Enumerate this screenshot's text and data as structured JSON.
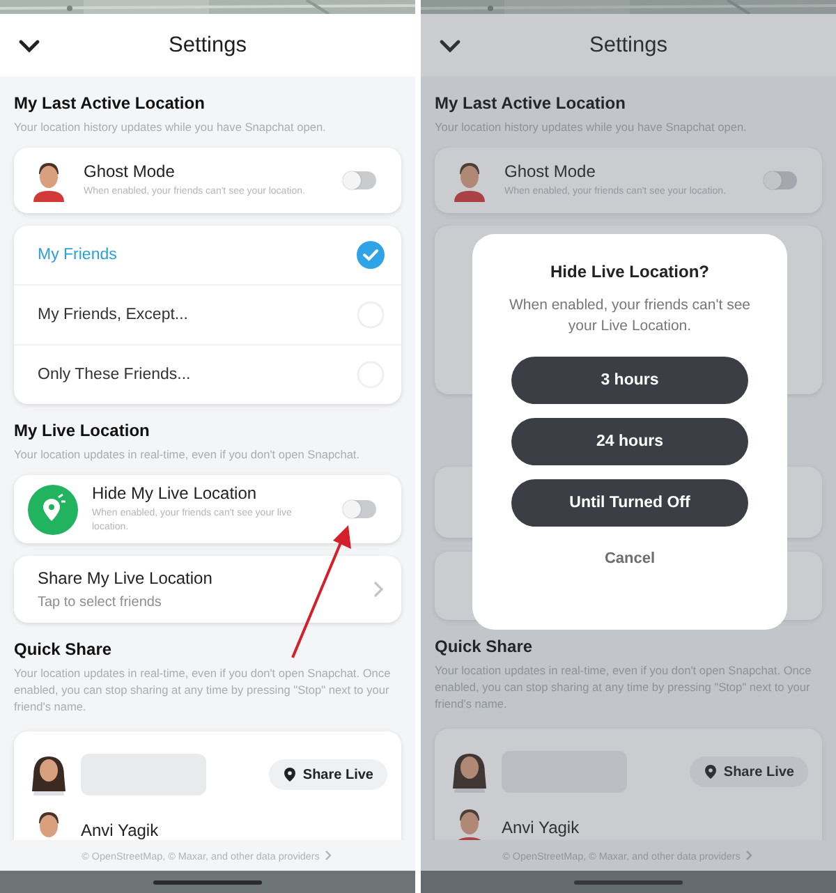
{
  "screens": [
    {
      "header": {
        "title": "Settings"
      },
      "pointer_arrow": true,
      "sections": [
        {
          "kind": "heading",
          "heading": "My Last Active Location",
          "note": "Your location history updates while you have Snapchat open."
        },
        {
          "kind": "avatar-toggle-card",
          "title": "Ghost Mode",
          "note": "When enabled, your friends can't see your location.",
          "on": false
        },
        {
          "kind": "radio-list",
          "items": [
            {
              "label": "My Friends",
              "selected": true
            },
            {
              "label": "My Friends, Except...",
              "selected": false
            },
            {
              "label": "Only These Friends...",
              "selected": false
            }
          ]
        },
        {
          "kind": "heading",
          "heading": "My Live Location",
          "note": "Your location updates in real-time, even if you don't open Snapchat."
        },
        {
          "kind": "pin-toggle-card",
          "title": "Hide My Live Location",
          "note": "When enabled, your friends can't see your live location.",
          "on": false
        },
        {
          "kind": "link-card",
          "title": "Share My Live Location",
          "note": "Tap to select friends"
        },
        {
          "kind": "heading",
          "heading": "Quick Share",
          "note": "Your location updates in real-time, even if you don't open Snapchat. Once enabled, you can stop sharing at any time by pressing \"Stop\" next to your friend's name."
        },
        {
          "kind": "friend-list",
          "items": [
            {
              "redacted": true,
              "button": "Share Live"
            },
            {
              "name": "Anvi Yagik"
            }
          ]
        }
      ],
      "footer": "© OpenStreetMap, © Maxar, and other data providers"
    },
    {
      "header": {
        "title": "Settings"
      },
      "sections": [
        {
          "kind": "heading",
          "heading": "My Last Active Location",
          "note": "Your location history updates while you have Snapchat open."
        },
        {
          "kind": "avatar-toggle-card",
          "title": "Ghost Mode",
          "note": "When enabled, your friends can't see your location.",
          "on": false
        },
        {
          "kind": "covered"
        },
        {
          "kind": "heading",
          "heading": "Quick Share",
          "note": "Your location updates in real-time, even if you don't open Snapchat. Once enabled, you can stop sharing at any time by pressing \"Stop\" next to your friend's name."
        },
        {
          "kind": "friend-list",
          "items": [
            {
              "redacted": true,
              "button": "Share Live"
            },
            {
              "name": "Anvi Yagik"
            }
          ]
        }
      ],
      "footer": "© OpenStreetMap, © Maxar, and other data providers",
      "dialog": {
        "title": "Hide Live Location?",
        "message": "When enabled, your friends can't see your Live Location.",
        "options": [
          "3 hours",
          "24 hours",
          "Until Turned Off"
        ],
        "cancel": "Cancel"
      }
    }
  ]
}
